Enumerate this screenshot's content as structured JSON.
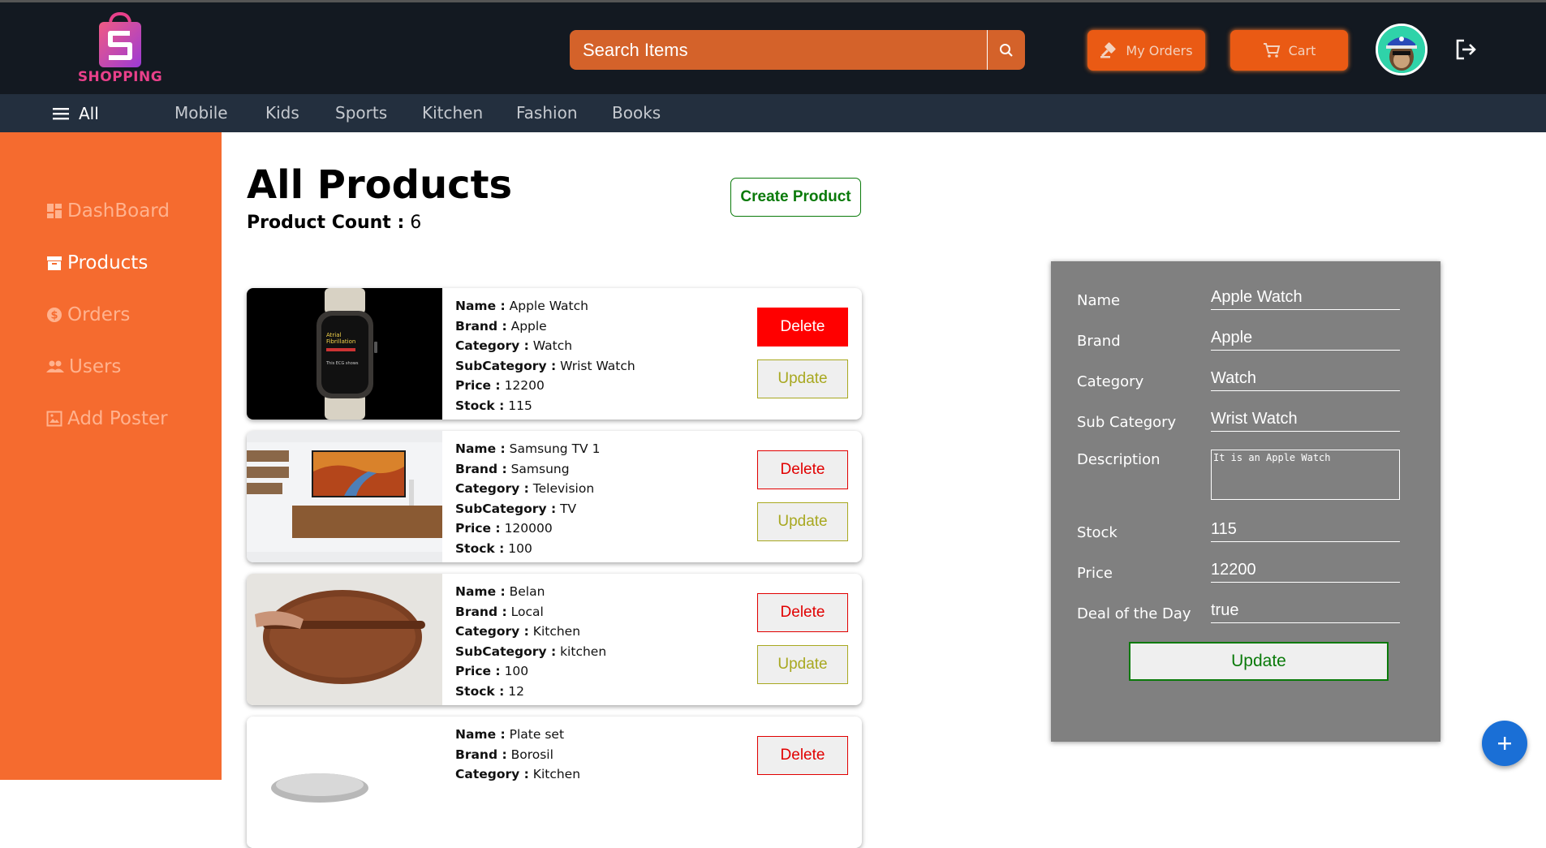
{
  "header": {
    "logo_text": "SHOPPING",
    "search_placeholder": "Search Items",
    "my_orders_label": "My Orders",
    "cart_label": "Cart"
  },
  "categories": {
    "all_label": "All",
    "items": [
      "Mobile",
      "Kids",
      "Sports",
      "Kitchen",
      "Fashion",
      "Books"
    ]
  },
  "sidebar": {
    "items": [
      {
        "label": "DashBoard",
        "icon": "dashboard-icon",
        "active": false
      },
      {
        "label": "Products",
        "icon": "archive-icon",
        "active": true
      },
      {
        "label": "Orders",
        "icon": "dollar-icon",
        "active": false
      },
      {
        "label": "Users",
        "icon": "users-icon",
        "active": false
      },
      {
        "label": "Add Poster",
        "icon": "image-icon",
        "active": false
      }
    ]
  },
  "main": {
    "title": "All Products",
    "count_label": "Product Count :",
    "count_value": "6",
    "create_label": "Create Product"
  },
  "labels": {
    "name": "Name :",
    "brand": "Brand :",
    "category": "Category :",
    "subcategory": "SubCategory :",
    "price": "Price :",
    "stock": "Stock :",
    "delete": "Delete",
    "update": "Update"
  },
  "products": [
    {
      "name": "Apple Watch",
      "brand": "Apple",
      "category": "Watch",
      "subcategory": "Wrist Watch",
      "price": "12200",
      "stock": "115"
    },
    {
      "name": "Samsung TV 1",
      "brand": "Samsung",
      "category": "Television",
      "subcategory": "TV",
      "price": "120000",
      "stock": "100"
    },
    {
      "name": "Belan",
      "brand": "Local",
      "category": "Kitchen",
      "subcategory": "kitchen",
      "price": "100",
      "stock": "12"
    },
    {
      "name": "Plate set",
      "brand": "Borosil",
      "category": "Kitchen",
      "subcategory": "",
      "price": "",
      "stock": ""
    }
  ],
  "edit_panel": {
    "name_label": "Name",
    "name_value": "Apple Watch",
    "brand_label": "Brand",
    "brand_value": "Apple",
    "category_label": "Category",
    "category_value": "Watch",
    "subcategory_label": "Sub Category",
    "subcategory_value": "Wrist Watch",
    "description_label": "Description",
    "description_value": "It is an Apple Watch",
    "stock_label": "Stock",
    "stock_value": "115",
    "price_label": "Price",
    "price_value": "12200",
    "deal_label": "Deal of the Day",
    "deal_value": "true",
    "update_label": "Update"
  },
  "colors": {
    "header_bg": "#131921",
    "category_bg": "#232f3e",
    "accent_orange": "#f56b2f",
    "panel_bg": "#808080",
    "delete_red": "#ff0000",
    "update_olive": "#a8a820",
    "create_green": "#0a7a0a"
  }
}
